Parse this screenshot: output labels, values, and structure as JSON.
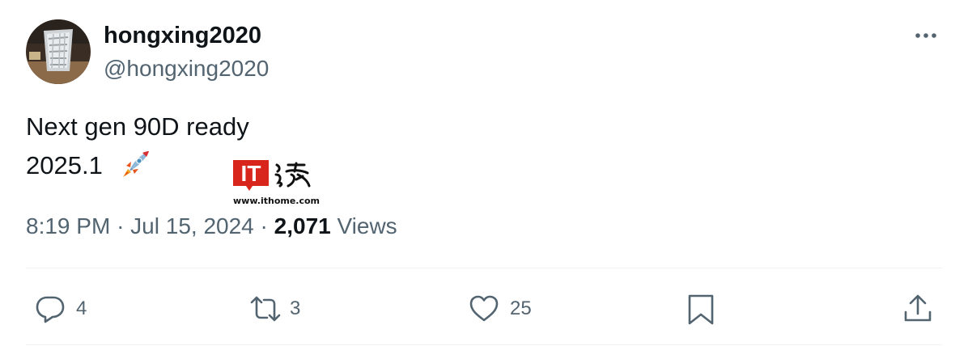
{
  "tweet": {
    "display_name": "hongxing2020",
    "handle": "@hongxing2020",
    "text_line1": "Next gen 90D ready",
    "text_line2": "2025.1",
    "emoji": "rocket-emoji",
    "time": "8:19 PM",
    "date": "Jul 15, 2024",
    "separator": "·",
    "views_count": "2,071",
    "views_label": "Views"
  },
  "watermark": {
    "logo_text": "IT",
    "url": "www.ithome.com"
  },
  "actions": {
    "reply_count": "4",
    "retweet_count": "3",
    "like_count": "25"
  },
  "colors": {
    "text_primary": "#0f1419",
    "text_secondary": "#536471",
    "divider": "#eff3f4",
    "watermark_red": "#d9261c"
  },
  "icons": [
    "more-icon",
    "reply-icon",
    "retweet-icon",
    "like-icon",
    "bookmark-icon",
    "share-icon"
  ]
}
